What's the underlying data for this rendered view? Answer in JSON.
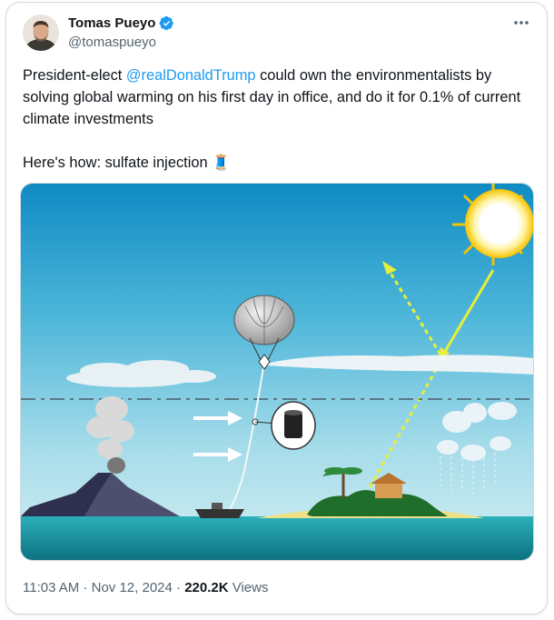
{
  "author": {
    "display_name": "Tomas Pueyo",
    "handle": "@tomaspueyo",
    "verified_color": "#1d9bf0"
  },
  "tweet": {
    "text_before": "President-elect ",
    "mention": "@realDonaldTrump",
    "text_after": " could own the environmentalists by solving global warming on his first day in office, and do it for 0.1% of current climate investments\n\nHere's how: sulfate injection ",
    "emoji": "🧵"
  },
  "media": {
    "icon": "sulfate-injection-illustration"
  },
  "meta": {
    "time": "11:03 AM",
    "sep1": " · ",
    "date": "Nov 12, 2024",
    "sep2": " · ",
    "views_count": "220.2K",
    "views_label": " Views"
  },
  "colors": {
    "mention": "#1d9bf0",
    "secondary_text": "#536471"
  }
}
